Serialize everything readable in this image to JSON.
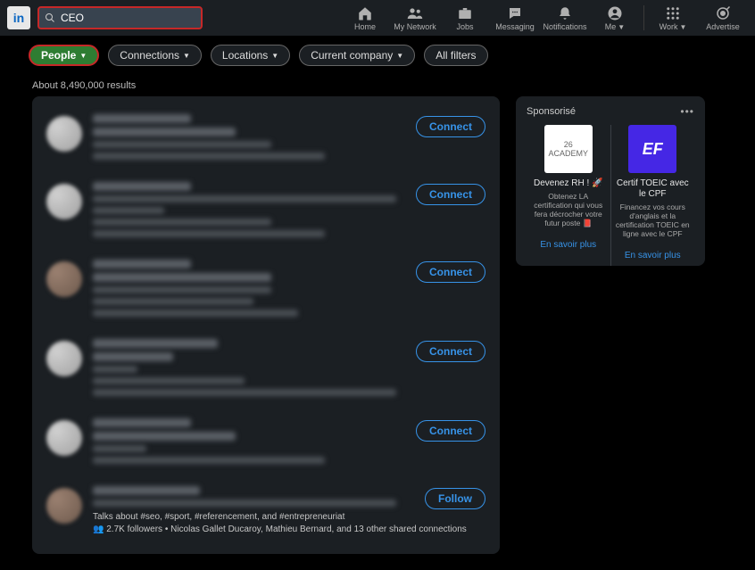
{
  "logo_text": "in",
  "search": {
    "value": "CEO"
  },
  "nav": [
    {
      "label": "Home"
    },
    {
      "label": "My Network"
    },
    {
      "label": "Jobs"
    },
    {
      "label": "Messaging"
    },
    {
      "label": "Notifications"
    },
    {
      "label": "Me",
      "caret": true
    },
    {
      "label": "Work",
      "caret": true
    },
    {
      "label": "Advertise"
    }
  ],
  "filters": {
    "people": "People",
    "connections": "Connections",
    "locations": "Locations",
    "company": "Current company",
    "all": "All filters"
  },
  "results_count": "About 8,490,000 results",
  "connect_label": "Connect",
  "follow_label": "Follow",
  "last_result": {
    "talks": "Talks about #seo, #sport, #referencement, and #entrepreneuriat",
    "followers": "2.7K followers • Nicolas Gallet Ducaroy, Mathieu Bernard, and 13 other shared connections"
  },
  "promo": {
    "header": "Sponsorisé",
    "slots": [
      {
        "title": "Devenez RH ! 🚀",
        "desc": "Obtenez LA certification qui vous fera décrocher votre futur poste 📕",
        "cta": "En savoir plus",
        "img_label": "26 ACADEMY"
      },
      {
        "title": "Certif TOEIC avec le CPF",
        "desc": "Financez vos cours d'anglais et la certification TOEIC en ligne avec le CPF",
        "cta": "En savoir plus",
        "img_label": "EF"
      }
    ]
  }
}
